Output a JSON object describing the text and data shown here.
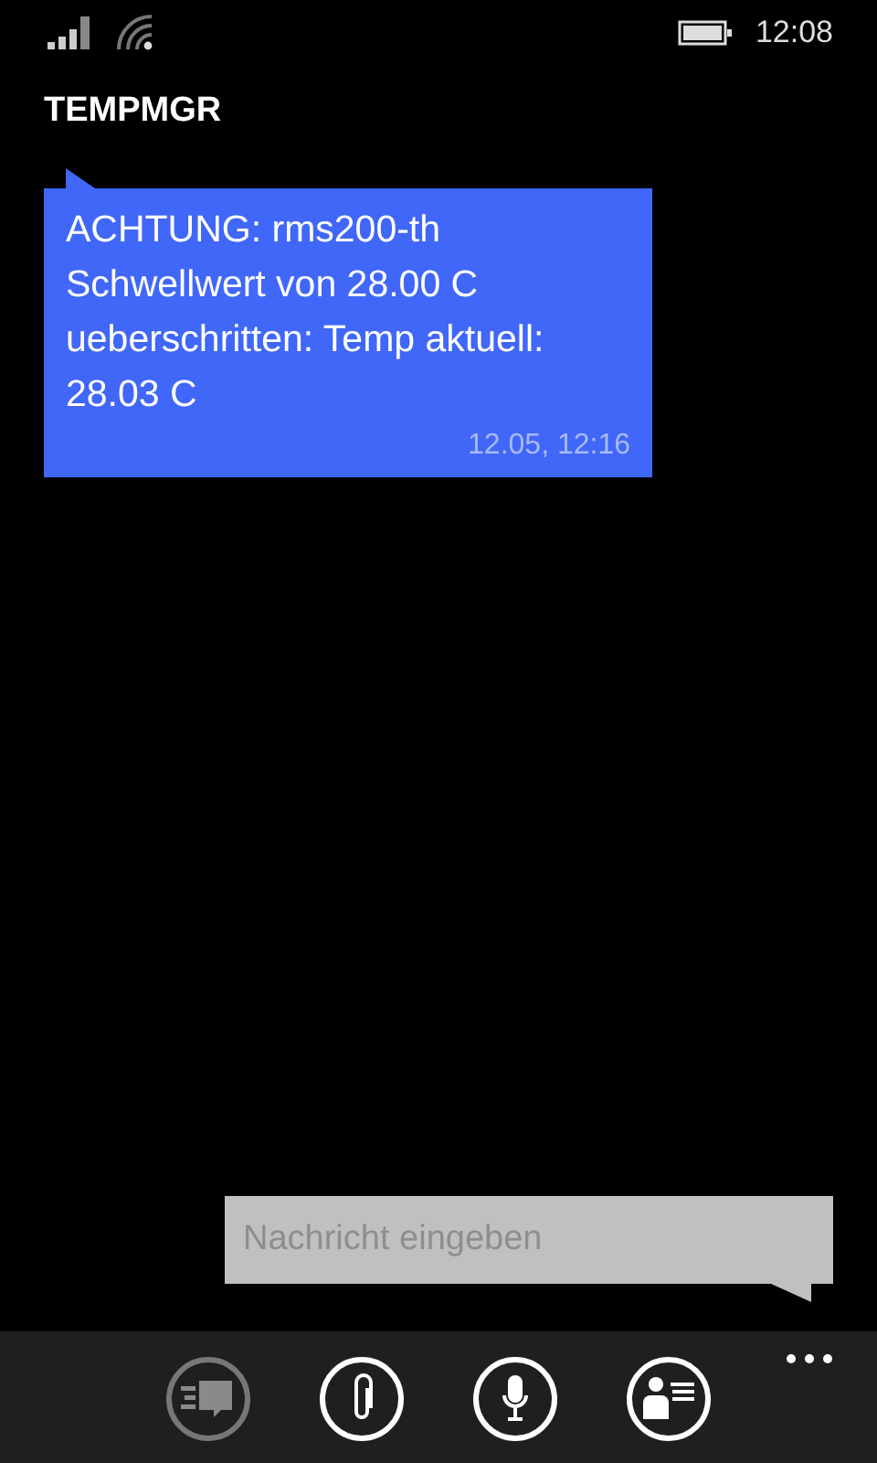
{
  "status_bar": {
    "time": "12:08"
  },
  "title": "TEMPMGR",
  "messages": [
    {
      "text": "ACHTUNG: rms200-th Schwellwert von 28.00 C ueberschritten: Temp aktuell: 28.03 C",
      "timestamp": "12.05, 12:16"
    }
  ],
  "compose": {
    "placeholder": "Nachricht eingeben"
  },
  "app_bar": {
    "buttons": [
      {
        "kind": "conversations",
        "disabled": true
      },
      {
        "kind": "attach",
        "disabled": false
      },
      {
        "kind": "microphone",
        "disabled": false
      },
      {
        "kind": "contact",
        "disabled": false
      }
    ]
  }
}
